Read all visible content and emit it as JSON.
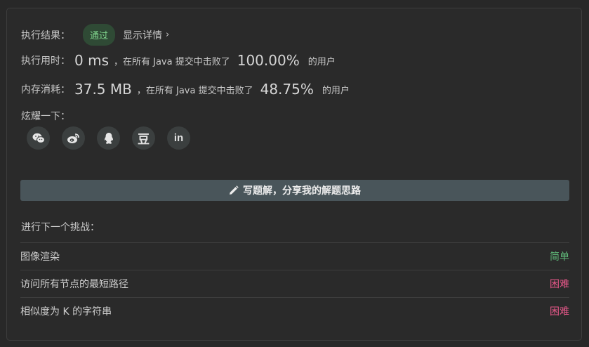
{
  "result": {
    "label": "执行结果：",
    "status": "通过",
    "details_link": "显示详情",
    "chevron": "›"
  },
  "runtime": {
    "label": "执行用时：",
    "value": "0 ms",
    "mid": "，在所有 Java 提交中击败了",
    "percent": "100.00%",
    "suffix": "的用户"
  },
  "memory": {
    "label": "内存消耗：",
    "value": "37.5 MB",
    "mid": "，在所有 Java 提交中击败了",
    "percent": "48.75%",
    "suffix": "的用户"
  },
  "share": {
    "label": "炫耀一下：",
    "icons": [
      "wechat-icon",
      "weibo-icon",
      "qq-icon",
      "douban-icon",
      "linkedin-icon"
    ],
    "douban_glyph": "豆",
    "linkedin_glyph": "in"
  },
  "write_solution": {
    "label": "写题解，分享我的解题思路",
    "icon": "pencil-icon"
  },
  "next_challenge": {
    "title": "进行下一个挑战：",
    "items": [
      {
        "title": "图像渲染",
        "difficulty": "简单",
        "color": "#5fb878"
      },
      {
        "title": "访问所有节点的最短路径",
        "difficulty": "困难",
        "color": "#e8588a"
      },
      {
        "title": "相似度为 K 的字符串",
        "difficulty": "困难",
        "color": "#e8588a"
      }
    ]
  },
  "colors": {
    "background": "#282828",
    "pass_badge_bg": "#2f4a35",
    "pass_badge_text": "#7fd38c",
    "button_bg": "#49555a"
  }
}
